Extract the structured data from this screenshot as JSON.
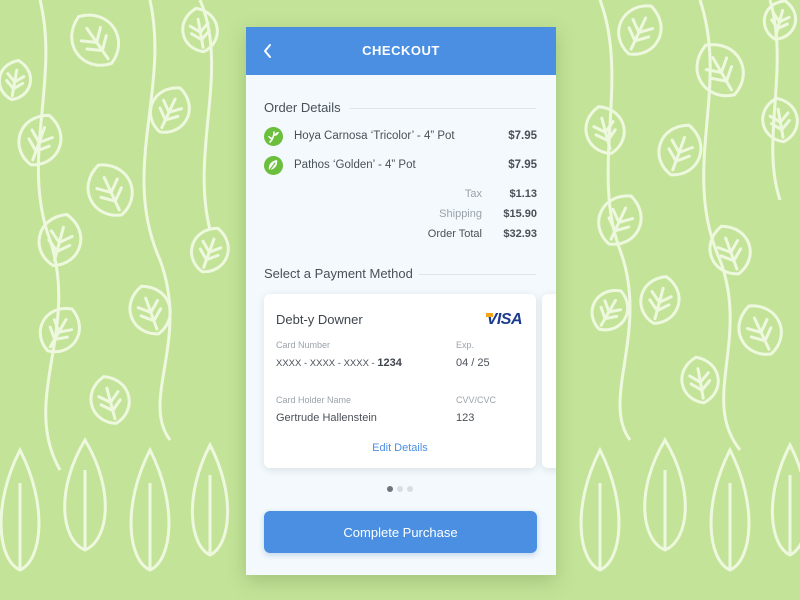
{
  "header": {
    "title": "CHECKOUT",
    "back_icon": "chevron-left-icon"
  },
  "order": {
    "title": "Order Details",
    "items": [
      {
        "name": "Hoya Carnosa ‘Tricolor’ - 4” Pot",
        "price": "$7.95",
        "icon": "plant-sprout-icon"
      },
      {
        "name": "Pathos ‘Golden’ - 4” Pot",
        "price": "$7.95",
        "icon": "leaf-icon"
      }
    ],
    "summary": [
      {
        "label": "Tax",
        "value": "$1.13"
      },
      {
        "label": "Shipping",
        "value": "$15.90"
      },
      {
        "label": "Order Total",
        "value": "$32.93"
      }
    ]
  },
  "payment": {
    "title": "Select a Payment Method",
    "card": {
      "name": "Debt-y Downer",
      "brand": "VISA",
      "number_label": "Card Number",
      "number_masked": "XXXX - XXXX - XXXX - ",
      "number_last4": "1234",
      "exp_label": "Exp.",
      "exp_value": "04 / 25",
      "holder_label": "Card Holder Name",
      "holder_value": "Gertrude Hallenstein",
      "cvv_label": "CVV/CVC",
      "cvv_value": "123",
      "edit_label": "Edit Details"
    },
    "pager": {
      "count": 3,
      "active_index": 0
    }
  },
  "cta": {
    "label": "Complete Purchase"
  },
  "colors": {
    "accent": "#4b8fe3",
    "background": "#c3e498",
    "item_icon": "#6bbf3c"
  }
}
